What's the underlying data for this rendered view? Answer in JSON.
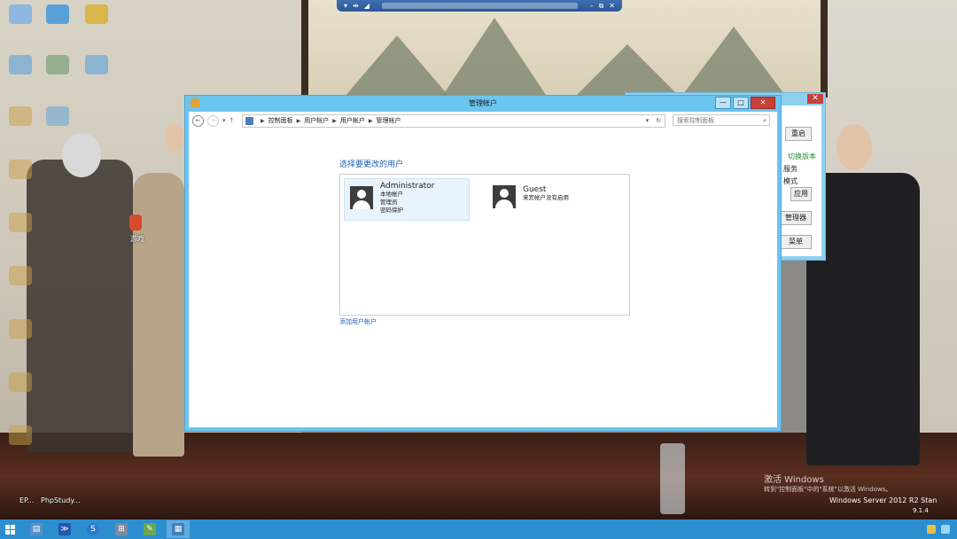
{
  "rdp_bar": {
    "left_icons": [
      "pin-icon",
      "move-icon",
      "signal-icon"
    ],
    "right_icons": [
      "minimize-icon",
      "restore-icon",
      "close-icon"
    ],
    "right_glyphs": [
      "–",
      "⧉",
      "✕"
    ]
  },
  "desktop": {
    "icon_labels": [
      "EP...",
      "PhpStudy..."
    ],
    "partial_label": "游戏"
  },
  "bg_window": {
    "close_glyph": "✕",
    "buttons": [
      "重启",
      "应用",
      "管理器",
      "菜单"
    ],
    "texts": [
      "切换版本",
      "服务",
      "模式"
    ],
    "accent_text_color": "#2a8a2a"
  },
  "window": {
    "title": "管理帐户",
    "controls": {
      "minimize": "—",
      "maximize": "□",
      "close": "✕"
    },
    "nav": {
      "back": "←",
      "forward": "→",
      "recent": "▾",
      "up": "↑"
    },
    "breadcrumb": [
      "控制面板",
      "用户帐户",
      "用户帐户",
      "管理帐户"
    ],
    "address_right": [
      "▾",
      "↻"
    ],
    "search": {
      "placeholder": "搜索控制面板",
      "icon": "⌕"
    },
    "heading": "选择要更改的用户",
    "users": [
      {
        "name": "Administrator",
        "details": [
          "本地帐户",
          "管理员",
          "密码保护"
        ]
      },
      {
        "name": "Guest",
        "details": [
          "来宾帐户没有启用"
        ]
      }
    ],
    "add_user_link": "添加用户帐户"
  },
  "watermark": {
    "title": "激活 Windows",
    "subtitle": "转到\"控制面板\"中的\"系统\"以激活 Windows。",
    "edition": "Windows Server 2012 R2 Stan",
    "build": "9.1.4"
  },
  "taskbar": {
    "items": [
      {
        "icon": "server-manager-icon",
        "glyph": "▤",
        "color": "#5a8fc7"
      },
      {
        "icon": "powershell-icon",
        "glyph": "≫",
        "color": "#2456a6"
      },
      {
        "icon": "sogou-browser-icon",
        "glyph": "S",
        "color": "#2f7ad1"
      },
      {
        "icon": "network-icon",
        "glyph": "⊞",
        "color": "#7c8a9a"
      },
      {
        "icon": "notepad-icon",
        "glyph": "✎",
        "color": "#6aa84f"
      },
      {
        "icon": "control-panel-icon",
        "glyph": "▦",
        "color": "#3f7fbf"
      }
    ],
    "active_index": 5,
    "tray": [
      "flag-icon",
      "network-tray-icon"
    ]
  }
}
